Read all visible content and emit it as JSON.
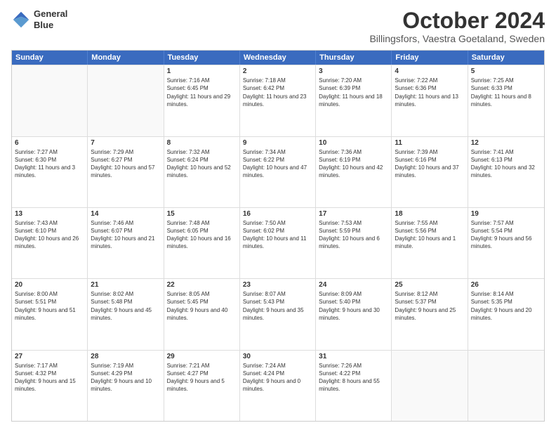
{
  "header": {
    "logo_line1": "General",
    "logo_line2": "Blue",
    "month": "October 2024",
    "location": "Billingsfors, Vaestra Goetaland, Sweden"
  },
  "days_of_week": [
    "Sunday",
    "Monday",
    "Tuesday",
    "Wednesday",
    "Thursday",
    "Friday",
    "Saturday"
  ],
  "weeks": [
    [
      {
        "day": "",
        "info": ""
      },
      {
        "day": "",
        "info": ""
      },
      {
        "day": "1",
        "info": "Sunrise: 7:16 AM\nSunset: 6:45 PM\nDaylight: 11 hours and 29 minutes."
      },
      {
        "day": "2",
        "info": "Sunrise: 7:18 AM\nSunset: 6:42 PM\nDaylight: 11 hours and 23 minutes."
      },
      {
        "day": "3",
        "info": "Sunrise: 7:20 AM\nSunset: 6:39 PM\nDaylight: 11 hours and 18 minutes."
      },
      {
        "day": "4",
        "info": "Sunrise: 7:22 AM\nSunset: 6:36 PM\nDaylight: 11 hours and 13 minutes."
      },
      {
        "day": "5",
        "info": "Sunrise: 7:25 AM\nSunset: 6:33 PM\nDaylight: 11 hours and 8 minutes."
      }
    ],
    [
      {
        "day": "6",
        "info": "Sunrise: 7:27 AM\nSunset: 6:30 PM\nDaylight: 11 hours and 3 minutes."
      },
      {
        "day": "7",
        "info": "Sunrise: 7:29 AM\nSunset: 6:27 PM\nDaylight: 10 hours and 57 minutes."
      },
      {
        "day": "8",
        "info": "Sunrise: 7:32 AM\nSunset: 6:24 PM\nDaylight: 10 hours and 52 minutes."
      },
      {
        "day": "9",
        "info": "Sunrise: 7:34 AM\nSunset: 6:22 PM\nDaylight: 10 hours and 47 minutes."
      },
      {
        "day": "10",
        "info": "Sunrise: 7:36 AM\nSunset: 6:19 PM\nDaylight: 10 hours and 42 minutes."
      },
      {
        "day": "11",
        "info": "Sunrise: 7:39 AM\nSunset: 6:16 PM\nDaylight: 10 hours and 37 minutes."
      },
      {
        "day": "12",
        "info": "Sunrise: 7:41 AM\nSunset: 6:13 PM\nDaylight: 10 hours and 32 minutes."
      }
    ],
    [
      {
        "day": "13",
        "info": "Sunrise: 7:43 AM\nSunset: 6:10 PM\nDaylight: 10 hours and 26 minutes."
      },
      {
        "day": "14",
        "info": "Sunrise: 7:46 AM\nSunset: 6:07 PM\nDaylight: 10 hours and 21 minutes."
      },
      {
        "day": "15",
        "info": "Sunrise: 7:48 AM\nSunset: 6:05 PM\nDaylight: 10 hours and 16 minutes."
      },
      {
        "day": "16",
        "info": "Sunrise: 7:50 AM\nSunset: 6:02 PM\nDaylight: 10 hours and 11 minutes."
      },
      {
        "day": "17",
        "info": "Sunrise: 7:53 AM\nSunset: 5:59 PM\nDaylight: 10 hours and 6 minutes."
      },
      {
        "day": "18",
        "info": "Sunrise: 7:55 AM\nSunset: 5:56 PM\nDaylight: 10 hours and 1 minute."
      },
      {
        "day": "19",
        "info": "Sunrise: 7:57 AM\nSunset: 5:54 PM\nDaylight: 9 hours and 56 minutes."
      }
    ],
    [
      {
        "day": "20",
        "info": "Sunrise: 8:00 AM\nSunset: 5:51 PM\nDaylight: 9 hours and 51 minutes."
      },
      {
        "day": "21",
        "info": "Sunrise: 8:02 AM\nSunset: 5:48 PM\nDaylight: 9 hours and 45 minutes."
      },
      {
        "day": "22",
        "info": "Sunrise: 8:05 AM\nSunset: 5:45 PM\nDaylight: 9 hours and 40 minutes."
      },
      {
        "day": "23",
        "info": "Sunrise: 8:07 AM\nSunset: 5:43 PM\nDaylight: 9 hours and 35 minutes."
      },
      {
        "day": "24",
        "info": "Sunrise: 8:09 AM\nSunset: 5:40 PM\nDaylight: 9 hours and 30 minutes."
      },
      {
        "day": "25",
        "info": "Sunrise: 8:12 AM\nSunset: 5:37 PM\nDaylight: 9 hours and 25 minutes."
      },
      {
        "day": "26",
        "info": "Sunrise: 8:14 AM\nSunset: 5:35 PM\nDaylight: 9 hours and 20 minutes."
      }
    ],
    [
      {
        "day": "27",
        "info": "Sunrise: 7:17 AM\nSunset: 4:32 PM\nDaylight: 9 hours and 15 minutes."
      },
      {
        "day": "28",
        "info": "Sunrise: 7:19 AM\nSunset: 4:29 PM\nDaylight: 9 hours and 10 minutes."
      },
      {
        "day": "29",
        "info": "Sunrise: 7:21 AM\nSunset: 4:27 PM\nDaylight: 9 hours and 5 minutes."
      },
      {
        "day": "30",
        "info": "Sunrise: 7:24 AM\nSunset: 4:24 PM\nDaylight: 9 hours and 0 minutes."
      },
      {
        "day": "31",
        "info": "Sunrise: 7:26 AM\nSunset: 4:22 PM\nDaylight: 8 hours and 55 minutes."
      },
      {
        "day": "",
        "info": ""
      },
      {
        "day": "",
        "info": ""
      }
    ]
  ]
}
